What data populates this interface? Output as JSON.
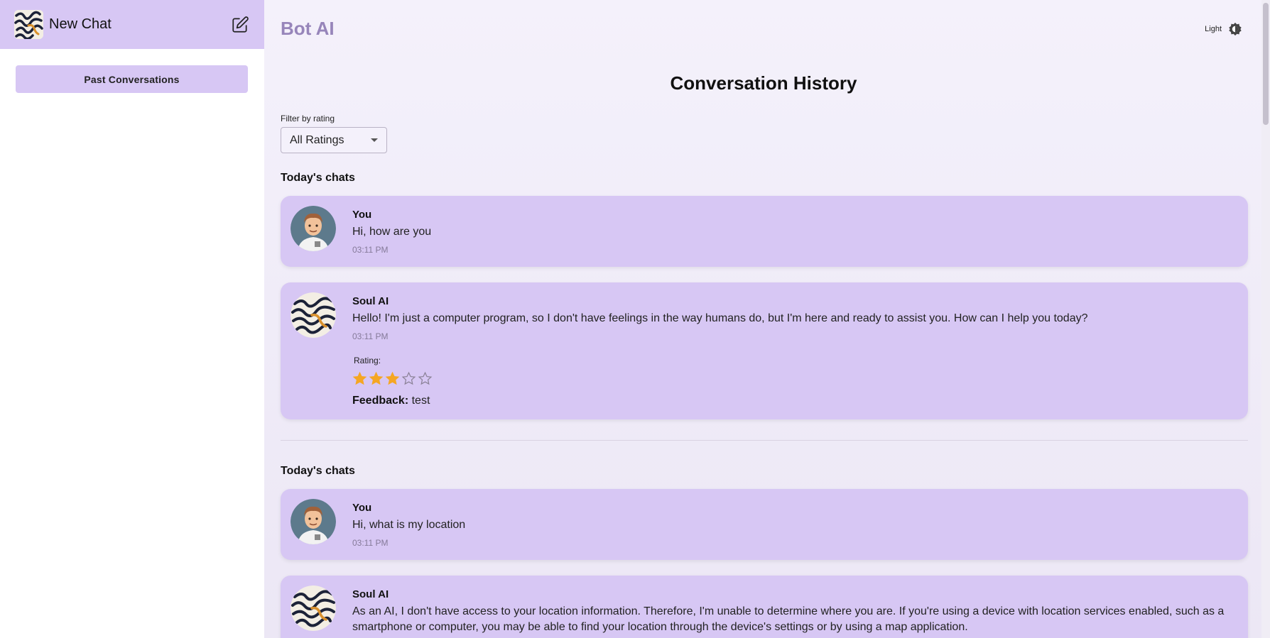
{
  "sidebar": {
    "title": "New Chat",
    "past_button": "Past Conversations",
    "logo_icon": "swirl-logo-icon",
    "edit_icon": "edit-icon"
  },
  "header": {
    "brand": "Bot AI",
    "theme_label": "Light",
    "theme_icon": "brightness-icon"
  },
  "main": {
    "title": "Conversation History",
    "filter": {
      "label": "Filter by rating",
      "selected": "All Ratings"
    },
    "groups": [
      {
        "heading": "Today's chats",
        "messages": [
          {
            "sender": "You",
            "text": "Hi, how are you",
            "time": "03:11 PM",
            "avatar": "user-avatar-icon"
          },
          {
            "sender": "Soul AI",
            "text": "Hello! I'm just a computer program, so I don't have feelings in the way humans do, but I'm here and ready to assist you. How can I help you today?",
            "time": "03:11 PM",
            "avatar": "bot-avatar-icon",
            "rating_label": "Rating:",
            "rating": 3,
            "rating_max": 5,
            "feedback_label": "Feedback:",
            "feedback": "test"
          }
        ]
      },
      {
        "heading": "Today's chats",
        "messages": [
          {
            "sender": "You",
            "text": "Hi, what is my location",
            "time": "03:11 PM",
            "avatar": "user-avatar-icon"
          },
          {
            "sender": "Soul AI",
            "text": "As an AI, I don't have access to your location information. Therefore, I'm unable to determine where you are. If you're using a device with location services enabled, such as a smartphone or computer, you may be able to find your location through the device's settings or by using a map application.",
            "avatar": "bot-avatar-icon"
          }
        ]
      }
    ]
  },
  "colors": {
    "accent": "#d7c7f4",
    "brand": "#9785ba",
    "star_filled": "#f5a623"
  }
}
